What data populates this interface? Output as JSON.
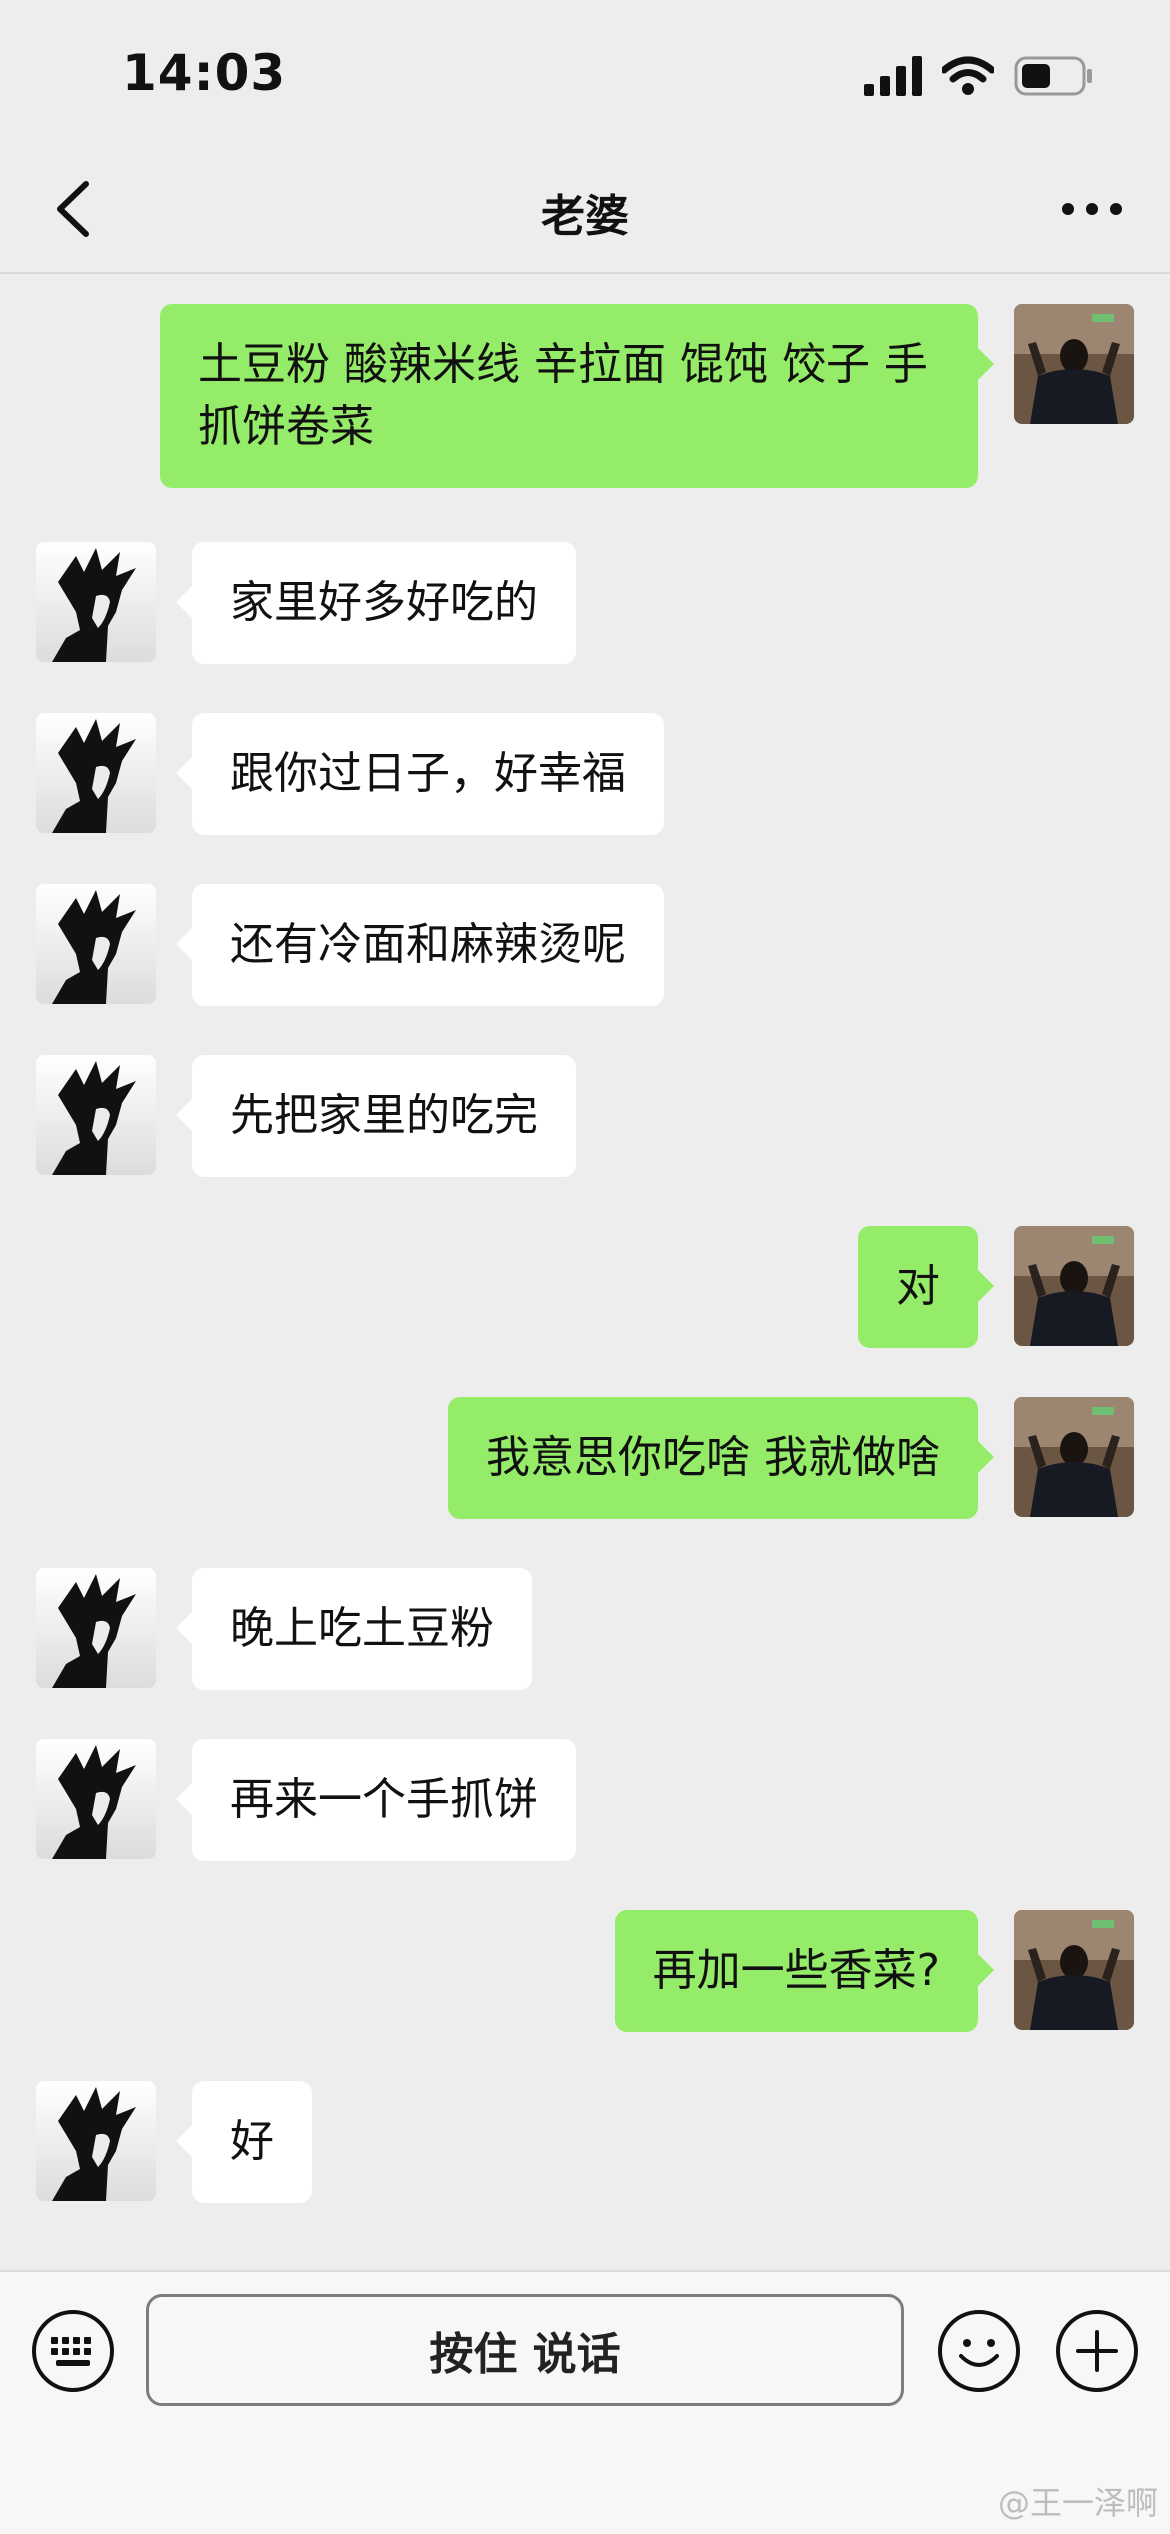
{
  "status_bar": {
    "time": "14:03",
    "icons": [
      "signal-icon",
      "wifi-icon",
      "battery-icon"
    ]
  },
  "nav": {
    "title": "老婆",
    "back_icon": "chevron-left-icon",
    "more_icon": "more-icon"
  },
  "messages": [
    {
      "side": "right",
      "text": "土豆粉 酸辣米线 辛拉面 馄饨 饺子 手抓饼卷菜"
    },
    {
      "side": "left",
      "text": "家里好多好吃的"
    },
    {
      "side": "left",
      "text": "跟你过日子，好幸福"
    },
    {
      "side": "left",
      "text": "还有冷面和麻辣烫呢"
    },
    {
      "side": "left",
      "text": "先把家里的吃完"
    },
    {
      "side": "right",
      "text": "对"
    },
    {
      "side": "right",
      "text": "我意思你吃啥 我就做啥"
    },
    {
      "side": "left",
      "text": "晚上吃土豆粉"
    },
    {
      "side": "left",
      "text": "再来一个手抓饼"
    },
    {
      "side": "right",
      "text": "再加一些香菜?"
    },
    {
      "side": "left",
      "text": "好"
    }
  ],
  "input_bar": {
    "hold_to_talk_label": "按住 说话",
    "icons": [
      "keyboard-icon",
      "emoji-icon",
      "plus-icon"
    ]
  },
  "watermark": "@王一泽啊",
  "colors": {
    "background": "#ededed",
    "outgoing_bubble": "#95ec69",
    "incoming_bubble": "#ffffff"
  }
}
